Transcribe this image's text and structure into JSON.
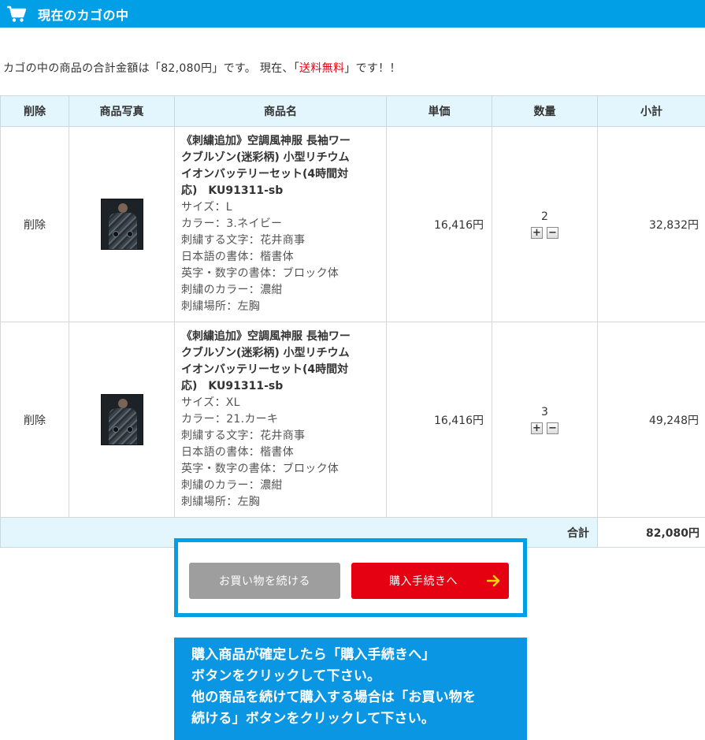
{
  "header": {
    "title": "現在のカゴの中",
    "icon": "cart-icon"
  },
  "summary": {
    "prefix": "カゴの中の商品の合計金額は「82,080円」です。 現在、「",
    "highlight": "送料無料",
    "suffix": "」です！！"
  },
  "table": {
    "headers": [
      "削除",
      "商品写真",
      "商品名",
      "単価",
      "数量",
      "小計"
    ],
    "rows": [
      {
        "delete_label": "削除",
        "name_lines": [
          "《刺繍追加》空調風神服 長袖ワー",
          "クブルゾン(迷彩柄) 小型リチウム",
          "イオンバッテリーセット(4時間対",
          "応)　KU91311-sb"
        ],
        "options": [
          "サイズ：L",
          "カラー：3.ネイビー",
          "刺繍する文字：花井商事",
          "日本語の書体：楷書体",
          "英字・数字の書体：ブロック体",
          "刺繍のカラー：濃紺",
          "刺繍場所：左胸"
        ],
        "unit_price": "16,416円",
        "quantity": "2",
        "subtotal": "32,832円"
      },
      {
        "delete_label": "削除",
        "name_lines": [
          "《刺繍追加》空調風神服 長袖ワー",
          "クブルゾン(迷彩柄) 小型リチウム",
          "イオンバッテリーセット(4時間対",
          "応)　KU91311-sb"
        ],
        "options": [
          "サイズ：XL",
          "カラー：21.カーキ",
          "刺繍する文字：花井商事",
          "日本語の書体：楷書体",
          "英字・数字の書体：ブロック体",
          "刺繍のカラー：濃紺",
          "刺繍場所：左胸"
        ],
        "unit_price": "16,416円",
        "quantity": "3",
        "subtotal": "49,248円"
      }
    ],
    "qty_plus": "+",
    "qty_minus": "−",
    "total_label": "合計",
    "total_value": "82,080円"
  },
  "buttons": {
    "continue_label": "お買い物を続ける",
    "checkout_label": "購入手続きへ"
  },
  "note": {
    "lines": [
      "購入商品が確定したら「購入手続きへ」",
      "ボタンをクリックして下さい。",
      "他の商品を続けて購入する場合は「お買い物を",
      "続ける」ボタンをクリックして下さい。"
    ]
  },
  "colors": {
    "accent": "#009fe6",
    "price_red": "#e8000b",
    "checkout_red": "#e50012",
    "continue_gray": "#9e9e9e",
    "header_bg": "#e3f5fd"
  }
}
